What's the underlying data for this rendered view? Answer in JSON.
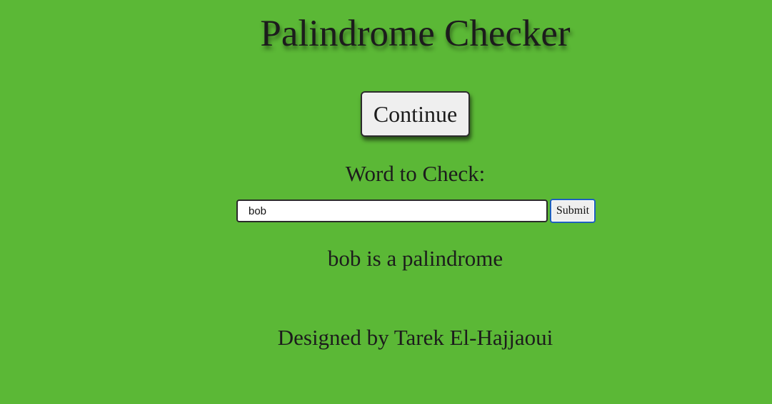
{
  "page": {
    "title": "Palindrome Checker",
    "background_color": "#5bb836"
  },
  "controls": {
    "continue_label": "Continue",
    "word_label": "Word to Check:",
    "word_input_value": "bob",
    "submit_label": "Submit"
  },
  "result": {
    "text": "bob is a palindrome"
  },
  "footer": {
    "credit": "Designed by Tarek El-Hajjaoui"
  }
}
